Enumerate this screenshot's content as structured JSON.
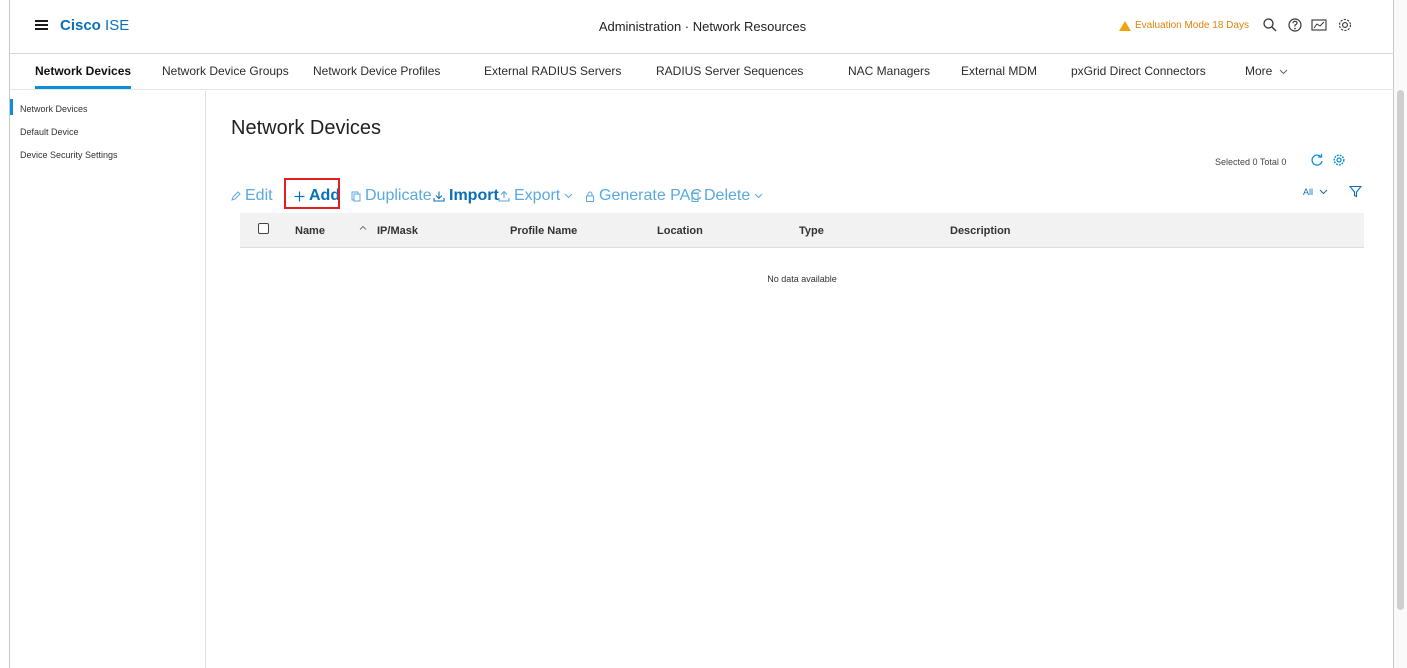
{
  "header": {
    "brand_bold": "Cisco",
    "brand_light": " ISE",
    "title": "Administration · Network Resources",
    "eval_text": "Evaluation Mode 18 Days"
  },
  "tabs": [
    {
      "label": "Network Devices",
      "active": true
    },
    {
      "label": "Network Device Groups"
    },
    {
      "label": "Network Device Profiles"
    },
    {
      "label": "External RADIUS Servers"
    },
    {
      "label": "RADIUS Server Sequences"
    },
    {
      "label": "NAC Managers"
    },
    {
      "label": "External MDM"
    },
    {
      "label": "pxGrid Direct Connectors"
    },
    {
      "label": "More"
    }
  ],
  "sidebar": {
    "items": [
      {
        "label": "Network Devices",
        "active": true
      },
      {
        "label": "Default Device"
      },
      {
        "label": "Device Security Settings"
      }
    ]
  },
  "main": {
    "title": "Network Devices",
    "selected_text": "Selected 0  Total 0",
    "toolbar": {
      "edit": "Edit",
      "add": "Add",
      "duplicate": "Duplicate",
      "import": "Import",
      "export": "Export",
      "generate_pac": "Generate PAC",
      "delete": "Delete",
      "filter": "All"
    },
    "table": {
      "columns": [
        "Name",
        "IP/Mask",
        "Profile Name",
        "Location",
        "Type",
        "Description"
      ],
      "rows": [],
      "empty_text": "No data available"
    }
  },
  "colors": {
    "brand": "#0a70b7",
    "accent": "#0d8fd6",
    "warning": "#e0820c",
    "highlight": "#e02020"
  }
}
